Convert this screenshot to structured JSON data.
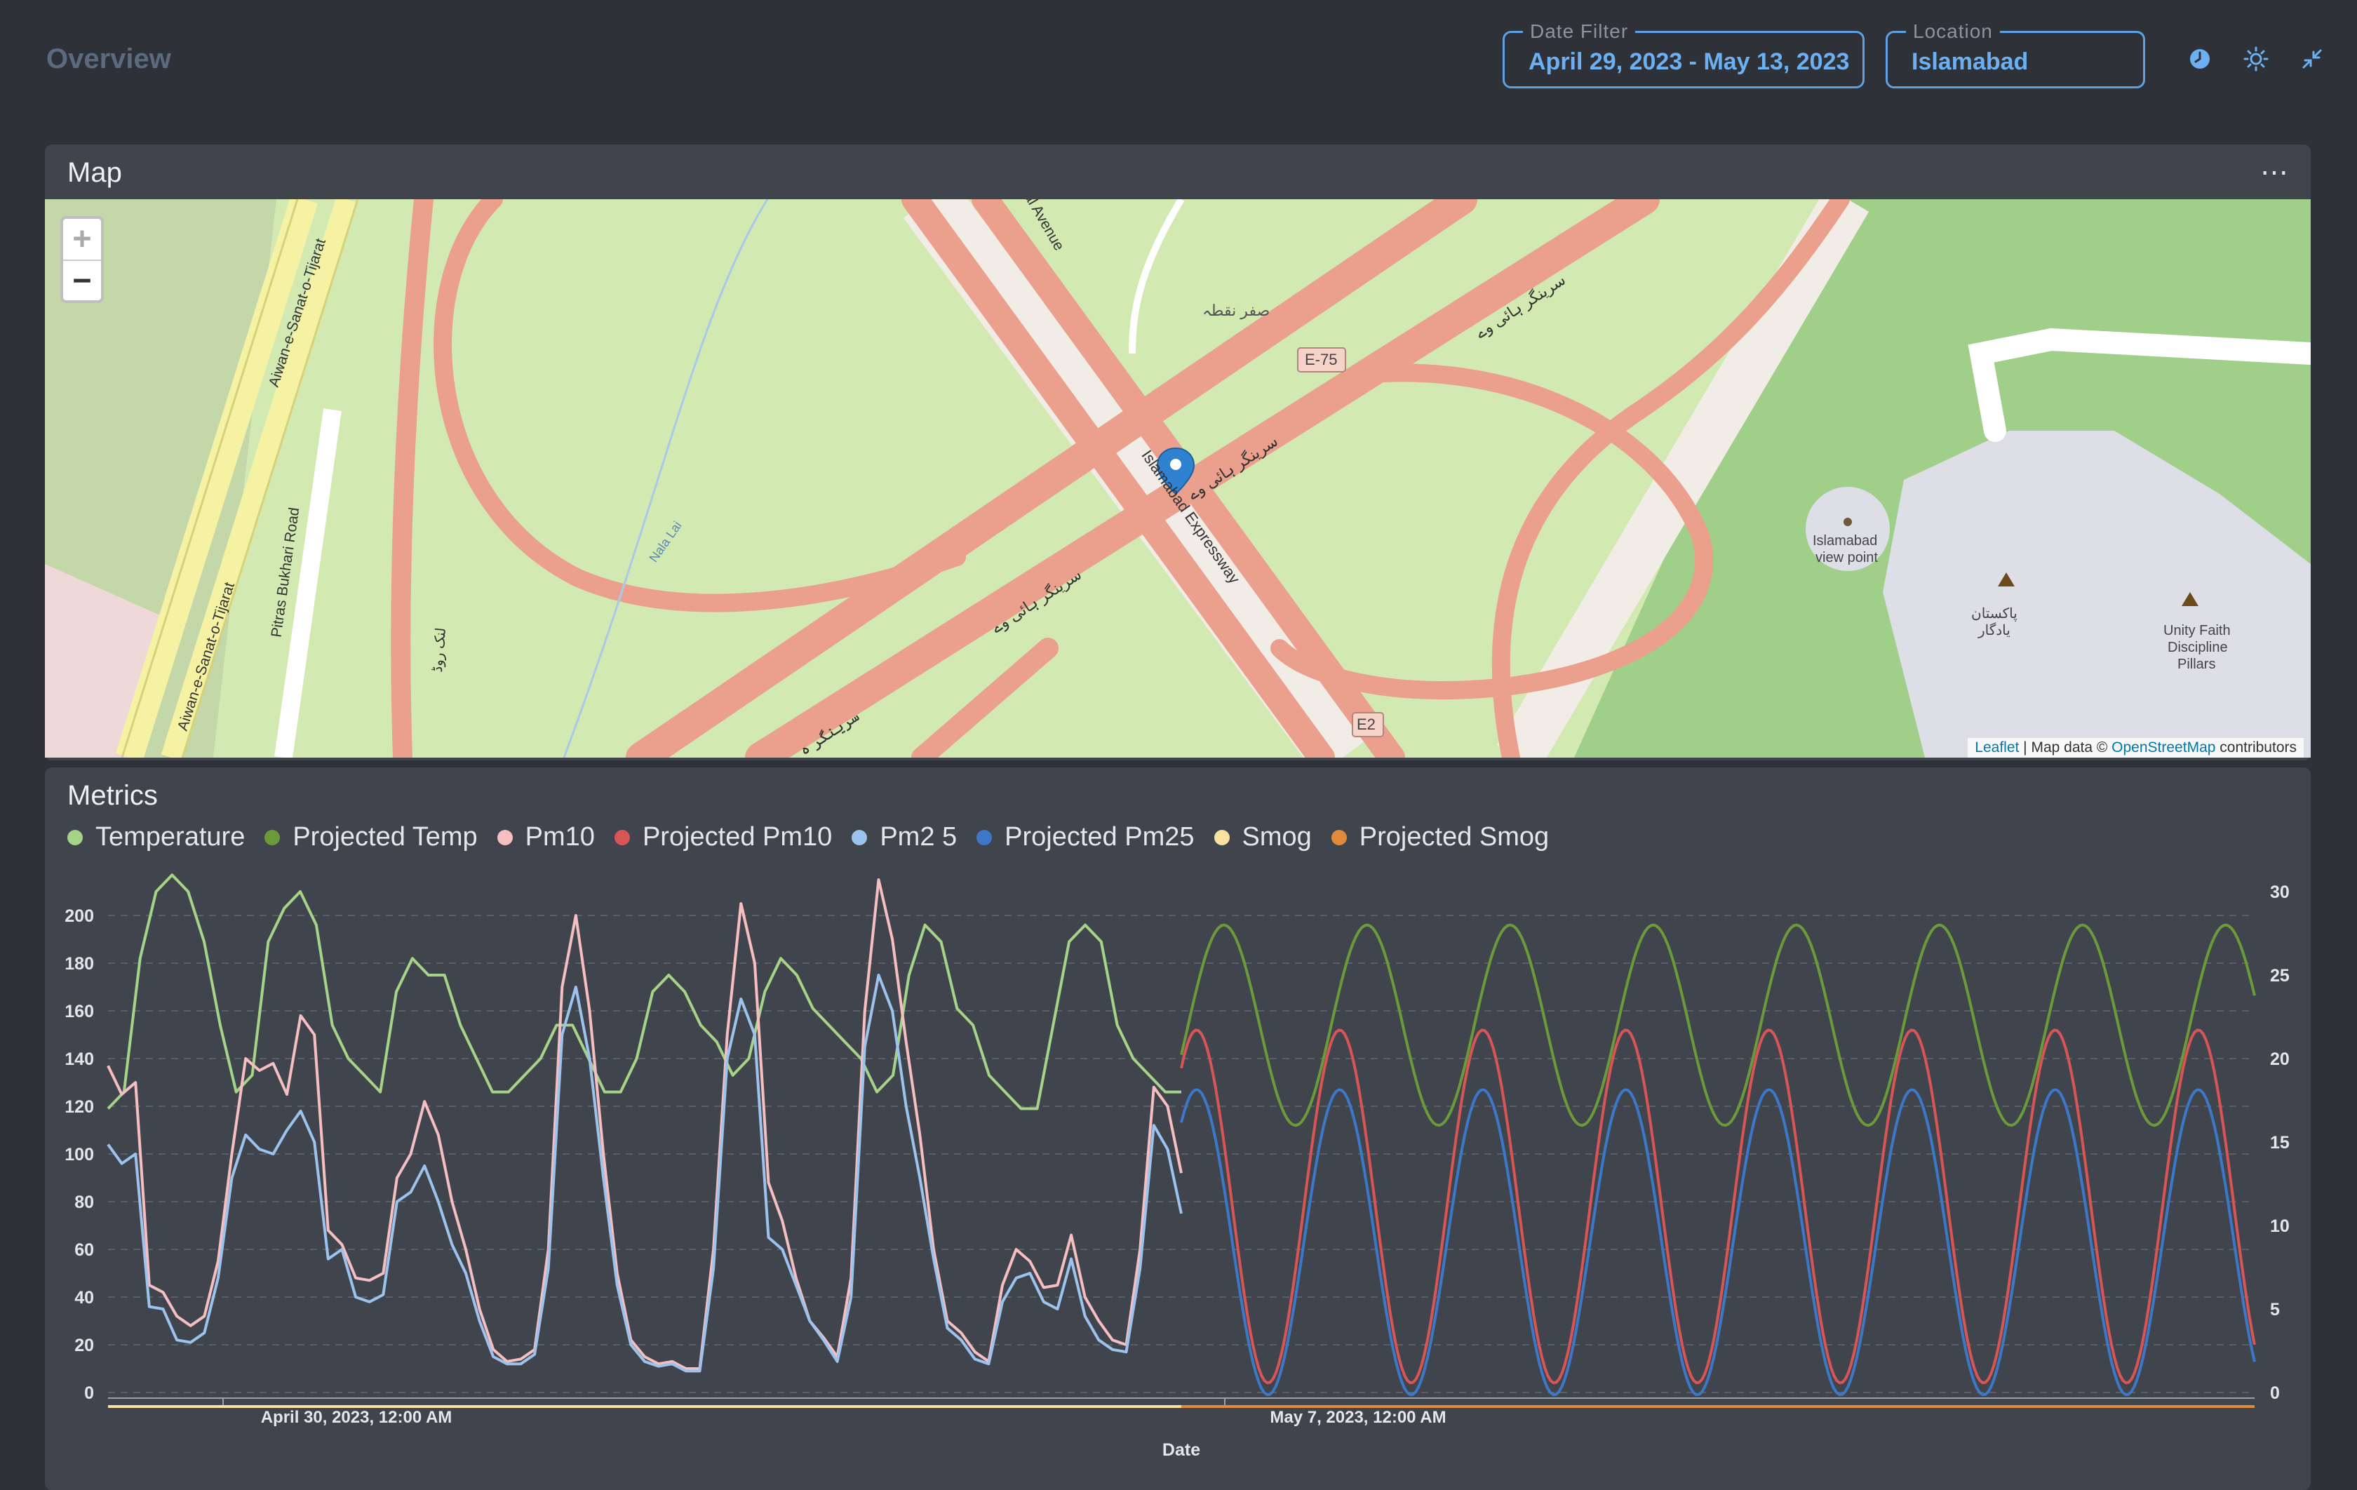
{
  "header": {
    "title": "Overview",
    "date_filter": {
      "label": "Date Filter",
      "value": "April 29, 2023 - May 13, 2023"
    },
    "location_filter": {
      "label": "Location",
      "value": "Islamabad"
    },
    "icons": [
      "clock-icon",
      "sun-icon",
      "collapse-icon"
    ]
  },
  "map_panel": {
    "title": "Map",
    "menu": "⋯",
    "zoom_in": "+",
    "zoom_out": "−",
    "labels": {
      "e75": "E-75",
      "e2": "E2",
      "zero_point": "صفر نقطہ",
      "srinagar_1": "سرینگر ہائی وے",
      "srinagar_2": "سرینگر ہائی وے",
      "srinagar_3": "سرینگر ہائی وے",
      "srinagar_4": "سرینگر ہ",
      "expressway": "Islamabad Expressway",
      "aiwan_1": "Aiwan-e-Sanat-o-Tijarat",
      "aiwan_2": "Aiwan-e-Sanat-o-Tijarat",
      "pitras": "Pitras Bukhari Road",
      "avenue": "al Avenue",
      "nala": "Nala Lai",
      "link_road": "لنک روڈ",
      "viewpoint_1": "Islamabad",
      "viewpoint_2": "view point",
      "pakistan_1": "پاکستان",
      "pakistan_2": "یادگار",
      "unity_1": "Unity Faith",
      "unity_2": "Discipline",
      "unity_3": "Pillars"
    },
    "attribution": {
      "leaflet": "Leaflet",
      "middle": " | Map data © ",
      "osm": "OpenStreetMap",
      "end": " contributors"
    }
  },
  "metrics_panel": {
    "title": "Metrics",
    "legend": [
      {
        "label": "Temperature",
        "color": "#a5d388"
      },
      {
        "label": "Projected Temp",
        "color": "#6a9a3a"
      },
      {
        "label": "Pm10",
        "color": "#f5bfc1"
      },
      {
        "label": "Projected Pm10",
        "color": "#d85555"
      },
      {
        "label": "Pm2 5",
        "color": "#9cc2ee"
      },
      {
        "label": "Projected Pm25",
        "color": "#3d78c8"
      },
      {
        "label": "Smog",
        "color": "#f7e2a0"
      },
      {
        "label": "Projected Smog",
        "color": "#e08a3c"
      }
    ]
  },
  "chart_data": {
    "type": "line",
    "xlabel": "Date",
    "x_ticks": [
      "April 30, 2023, 12:00 AM",
      "May 7, 2023, 12:00 AM"
    ],
    "y_left": {
      "ticks": [
        0,
        20,
        40,
        60,
        80,
        100,
        120,
        140,
        160,
        180,
        200
      ],
      "range": [
        0,
        200
      ]
    },
    "y_right": {
      "ticks": [
        0,
        5,
        10,
        15,
        20,
        25,
        30
      ],
      "range": [
        0,
        30
      ]
    },
    "grid": true,
    "observed": {
      "x_day_start": 0,
      "x_day_end": 7.5,
      "temperature_c": [
        17,
        18,
        26,
        30,
        31,
        30,
        27,
        22,
        18,
        19,
        27,
        29,
        30,
        28,
        22,
        20,
        19,
        18,
        24,
        26,
        25,
        25,
        22,
        20,
        18,
        18,
        19,
        20,
        22,
        22,
        20,
        18,
        18,
        20,
        24,
        25,
        24,
        22,
        21,
        19,
        20,
        24,
        26,
        25,
        23,
        22,
        21,
        20,
        18,
        19,
        25,
        28,
        27,
        23,
        22,
        19,
        18,
        17,
        17,
        22,
        27,
        28,
        27,
        22,
        20,
        19,
        18,
        18
      ],
      "pm10": [
        137,
        125,
        130,
        45,
        42,
        32,
        28,
        32,
        55,
        100,
        140,
        135,
        138,
        125,
        158,
        150,
        68,
        62,
        48,
        47,
        50,
        90,
        100,
        122,
        108,
        80,
        60,
        35,
        18,
        13,
        14,
        18,
        60,
        170,
        200,
        160,
        100,
        50,
        22,
        15,
        12,
        13,
        10,
        10,
        60,
        150,
        205,
        180,
        88,
        72,
        48,
        30,
        23,
        15,
        48,
        160,
        215,
        190,
        147,
        108,
        60,
        30,
        25,
        17,
        13,
        45,
        60,
        55,
        44,
        45,
        66,
        40,
        30,
        22,
        20,
        60,
        128,
        120,
        92
      ],
      "pm25": [
        104,
        96,
        100,
        36,
        35,
        22,
        21,
        25,
        48,
        90,
        108,
        102,
        100,
        110,
        118,
        105,
        56,
        60,
        40,
        38,
        41,
        80,
        84,
        95,
        80,
        62,
        50,
        30,
        15,
        12,
        12,
        16,
        52,
        150,
        170,
        140,
        90,
        45,
        20,
        13,
        11,
        12,
        9,
        9,
        52,
        140,
        165,
        150,
        65,
        60,
        45,
        30,
        22,
        13,
        40,
        145,
        175,
        160,
        120,
        90,
        56,
        27,
        22,
        14,
        12,
        38,
        48,
        50,
        38,
        35,
        56,
        32,
        22,
        18,
        17,
        52,
        112,
        102,
        75
      ],
      "smog": 0
    },
    "projected": {
      "x_day_start": 7.5,
      "x_day_end": 15,
      "temp_mean_c": 22,
      "temp_amplitude_c": 6,
      "pm10_mean": 78,
      "pm10_amplitude": 74,
      "pm25_mean": 63,
      "pm25_amplitude": 64,
      "period_days": 1,
      "smog": 0
    }
  }
}
